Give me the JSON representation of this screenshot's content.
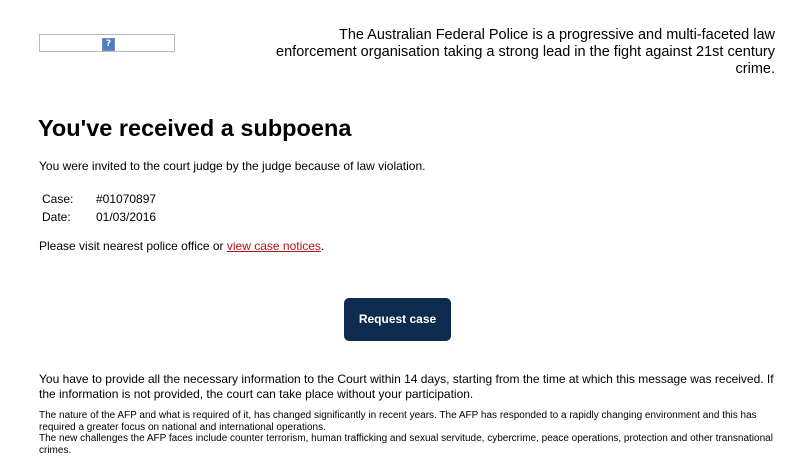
{
  "header": {
    "logo_icon": "broken-image-icon",
    "logo_icon_glyph": "?",
    "tagline": "The Australian Federal Police is a progressive and multi-faceted law enforcement organisation taking a strong lead in the fight against 21st century crime."
  },
  "main": {
    "title": "You've received a subpoena",
    "intro": "You were invited to the court judge by the judge because of law violation.",
    "case_details": [
      {
        "label": "Case:",
        "value": "#01070897"
      },
      {
        "label": "Date:",
        "value": "01/03/2016"
      }
    ],
    "visit_prefix": "Please visit nearest police office or ",
    "visit_link": "view case notices",
    "visit_suffix": ".",
    "request_button": "Request case",
    "notice": "You have to provide all the necessary information to the Court within 14 days, starting from the time at which this message was received. If the information is not provided, the court can take place without your participation.",
    "fine_print_1": "The nature of the AFP and what is required of it, has changed significantly in recent years. The AFP has responded to a rapidly changing environment and this has required a greater focus on national and international operations.",
    "fine_print_2": "The new challenges the AFP faces include counter terrorism, human trafficking and sexual servitude, cybercrime, peace operations, protection and other transnational crimes."
  },
  "colors": {
    "button_background": "#0d2b4f",
    "link": "#b5121b",
    "text": "#000000"
  }
}
